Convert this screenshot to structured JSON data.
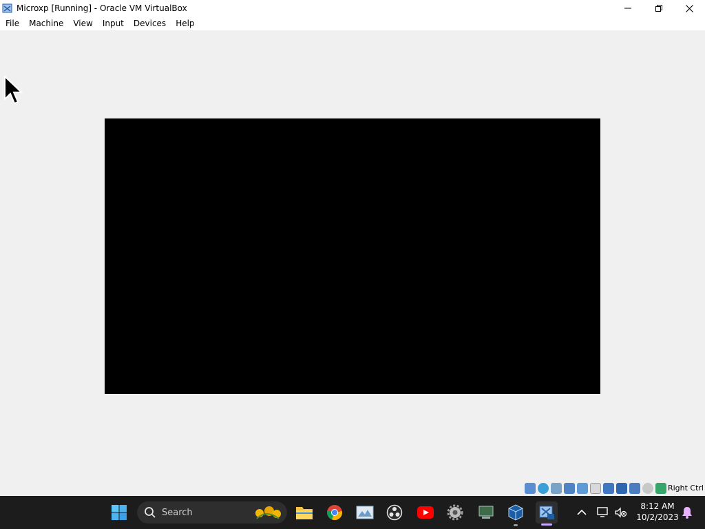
{
  "window": {
    "title": "Microxp [Running] - Oracle VM VirtualBox"
  },
  "menu": [
    "File",
    "Machine",
    "View",
    "Input",
    "Devices",
    "Help"
  ],
  "statusbar": {
    "host_key": "Right Ctrl",
    "icons": [
      "hard-disk-icon",
      "optical-drive-icon",
      "audio-icon",
      "network-icon",
      "usb-icon",
      "shared-folders-icon",
      "display-icon",
      "recording-icon",
      "virtualization-icon",
      "mouse-integration-icon",
      "keyboard-capture-icon"
    ]
  },
  "taskbar": {
    "search_placeholder": "Search",
    "time": "8:12 AM",
    "date": "10/2/2023",
    "apps": [
      "start-icon",
      "file-explorer-icon",
      "chrome-icon",
      "photos-icon",
      "obs-icon",
      "youtube-icon",
      "settings-icon",
      "app-icon",
      "virtualbox-icon",
      "vm-xp-icon"
    ]
  },
  "colors": {
    "taskbar_bg": "#1c1c1c",
    "chrome_red": "#db4437",
    "chrome_yellow": "#f4b400",
    "chrome_green": "#0f9d58",
    "chrome_blue": "#4285f4",
    "youtube_red": "#ff0000",
    "active_indicator": "#c9a6ff"
  }
}
